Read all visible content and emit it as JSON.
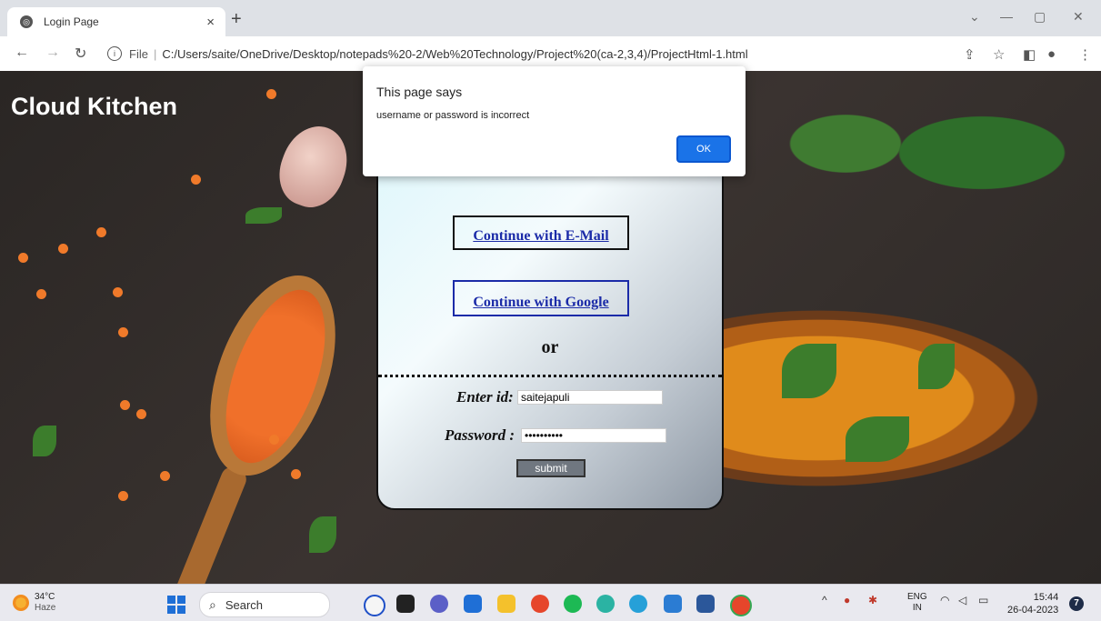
{
  "browser": {
    "tab_title": "Login Page",
    "tab_close": "×",
    "new_tab": "+",
    "url_file": "File",
    "url_sep": "|",
    "url": "C:/Users/saite/OneDrive/Desktop/notepads%20-2/Web%20Technology/Project%20(ca-2,3,4)/ProjectHtml-1.html"
  },
  "page": {
    "brand": "Cloud Kitchen",
    "login": {
      "email_button": "Continue with E-Mail",
      "google_button": "Continue with Google",
      "or_text": "or",
      "id_label": "Enter id:",
      "id_value": "saitejapuli",
      "password_label": "Password :",
      "password_value": "••••••••••",
      "submit_label": "submit"
    }
  },
  "dialog": {
    "title": "This page says",
    "message": "username or password is incorrect",
    "ok_label": "OK"
  },
  "taskbar": {
    "weather_temp": "34°C",
    "weather_condition": "Haze",
    "search_label": "Search",
    "lang_top": "ENG",
    "lang_bottom": "IN",
    "time": "15:44",
    "date": "26-04-2023",
    "notification_count": "7"
  }
}
